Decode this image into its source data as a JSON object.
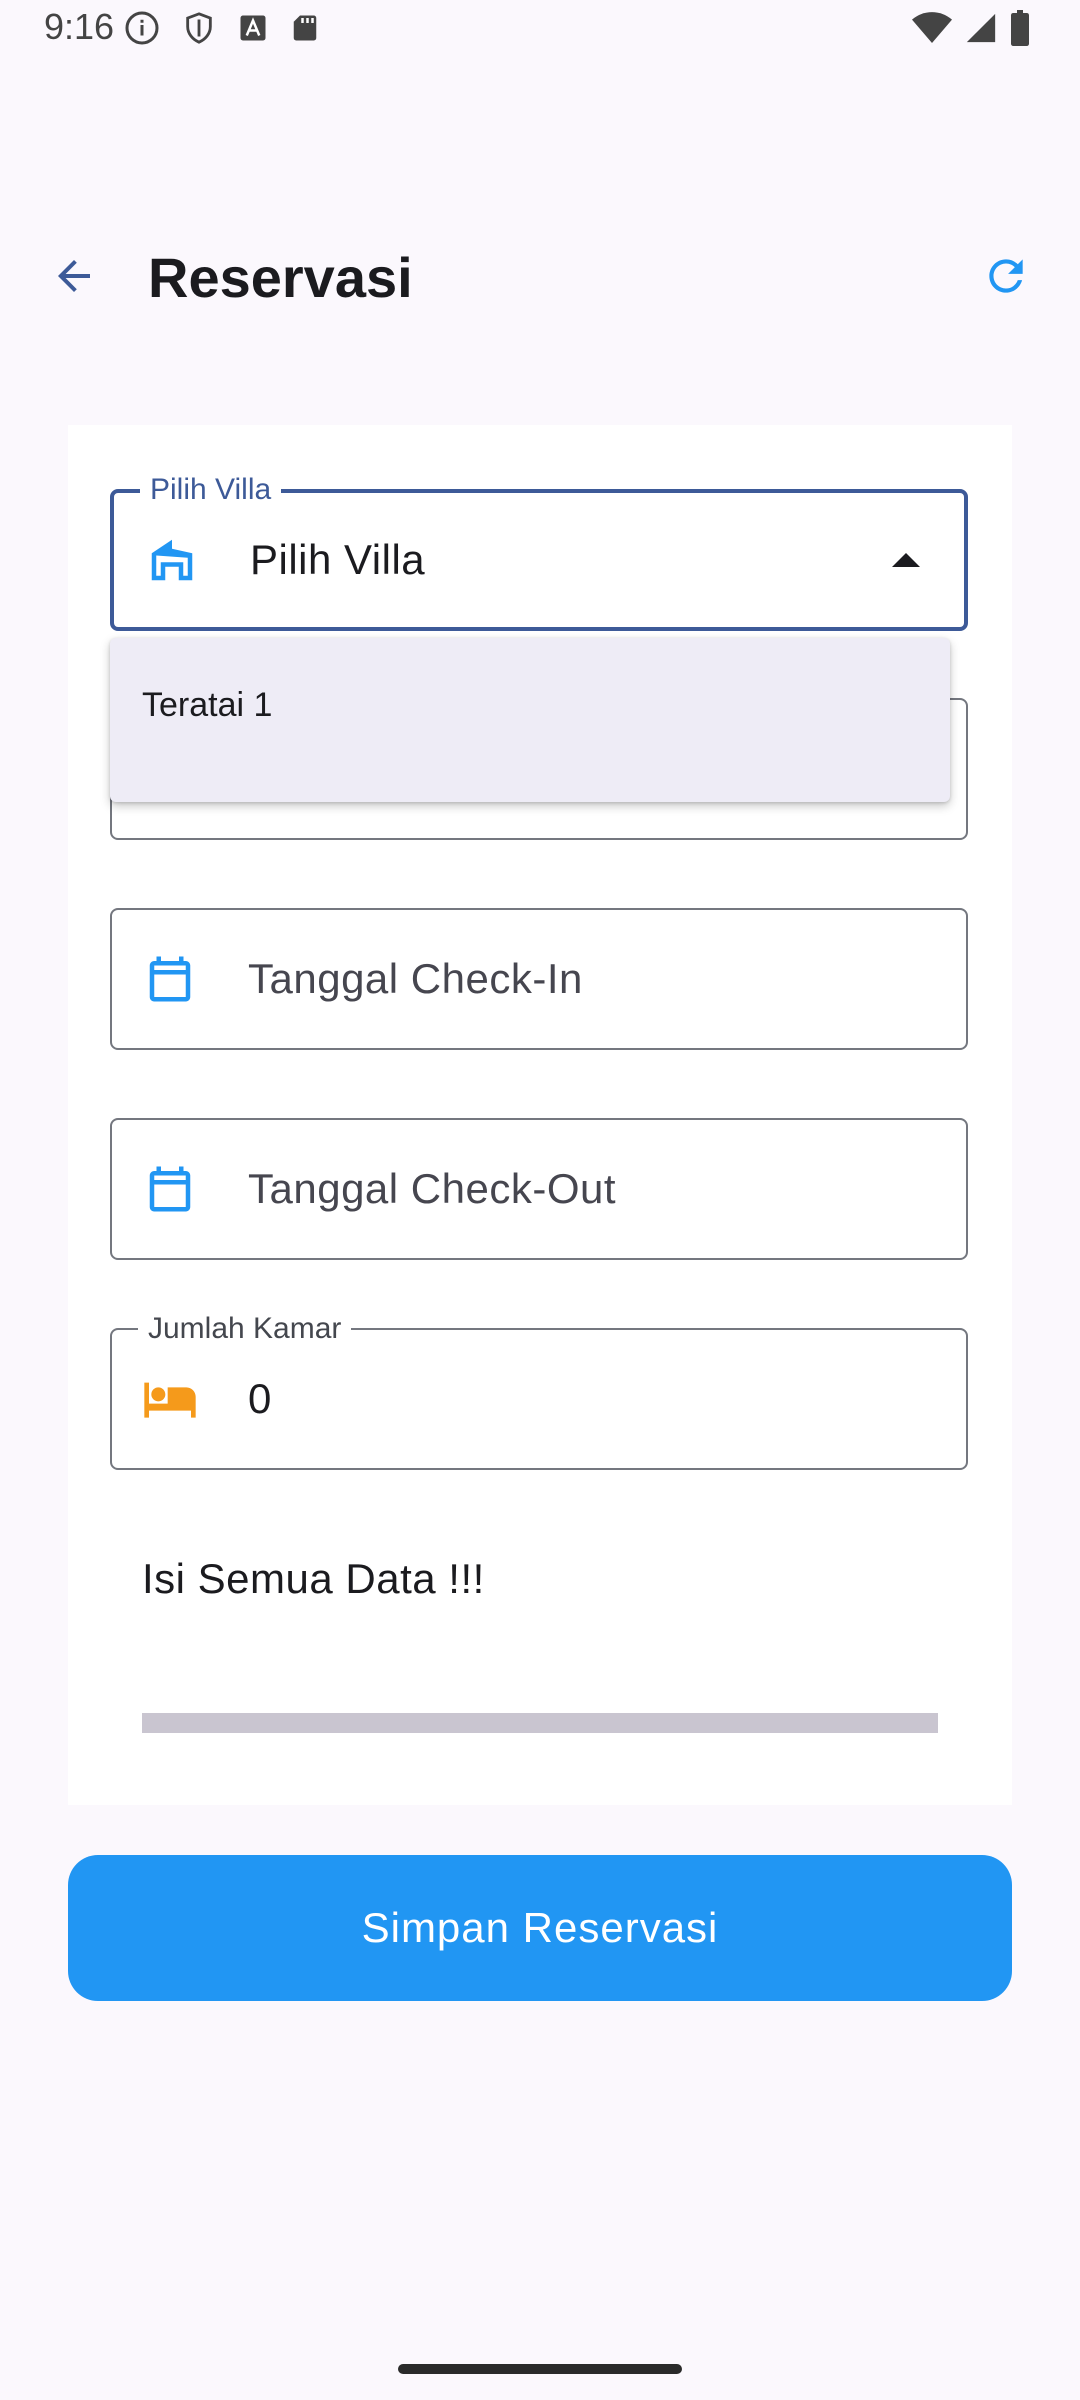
{
  "status_bar": {
    "time": "9:16",
    "left_icons": [
      "info-icon",
      "shield-icon",
      "font-icon",
      "sd-card-icon"
    ],
    "right_icons": [
      "wifi-icon",
      "signal-icon",
      "battery-icon"
    ]
  },
  "app_bar": {
    "title": "Reservasi",
    "back_icon": "arrow-back-icon",
    "refresh_icon": "refresh-icon"
  },
  "form": {
    "villa": {
      "label": "Pilih Villa",
      "value": "Pilih Villa",
      "icon": "villa-icon",
      "expanded": true,
      "options": [
        "Teratai 1"
      ]
    },
    "check_in": {
      "placeholder": "Tanggal Check-In",
      "icon": "calendar-icon"
    },
    "check_out": {
      "placeholder": "Tanggal Check-Out",
      "icon": "calendar-icon"
    },
    "rooms": {
      "label": "Jumlah Kamar",
      "value": "0",
      "icon": "bed-icon"
    },
    "message": "Isi Semua Data !!!",
    "progress": 0
  },
  "save_button": {
    "label": "Simpan Reservasi"
  },
  "colors": {
    "accent": "#2196f3",
    "focus_border": "#3d5a98",
    "bed_icon": "#f59a1b",
    "background": "#fbf8fd"
  }
}
